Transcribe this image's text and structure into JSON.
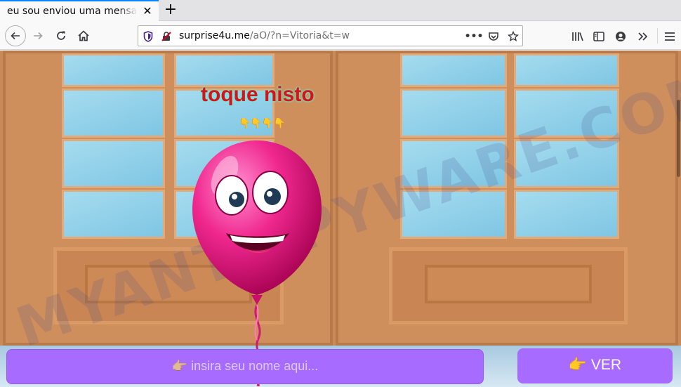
{
  "browser": {
    "tab_title": "eu sou enviou uma mensagem",
    "tab_close": "✕",
    "new_tab": "+",
    "url_host": "surprise4u.me",
    "url_path": "/aO/?n=Vitoria&t=w",
    "accent_color": "#0a84ff"
  },
  "icons": {
    "back": "arrow-left-icon",
    "forward": "arrow-right-icon",
    "reload": "reload-icon",
    "home": "home-icon",
    "shield": "tracking-protection-icon",
    "insecure": "insecure-lock-icon",
    "page_actions": "more-dots-icon",
    "pocket": "pocket-icon",
    "bookmark": "star-icon",
    "library": "library-icon",
    "sidebar": "sidebar-icon",
    "account": "account-icon",
    "overflow": "chevron-double-right-icon",
    "menu": "hamburger-menu-icon"
  },
  "page": {
    "headline": "toque nisto",
    "pointer_emojis": "👇👇👇👇",
    "watermark": "MYANTISPYWARE.COM",
    "name_placeholder": "👉🏼 insira seu nome aqui...",
    "ver_label": "👉 VER",
    "button_color": "#a86bff",
    "headline_color": "#d8121d"
  }
}
